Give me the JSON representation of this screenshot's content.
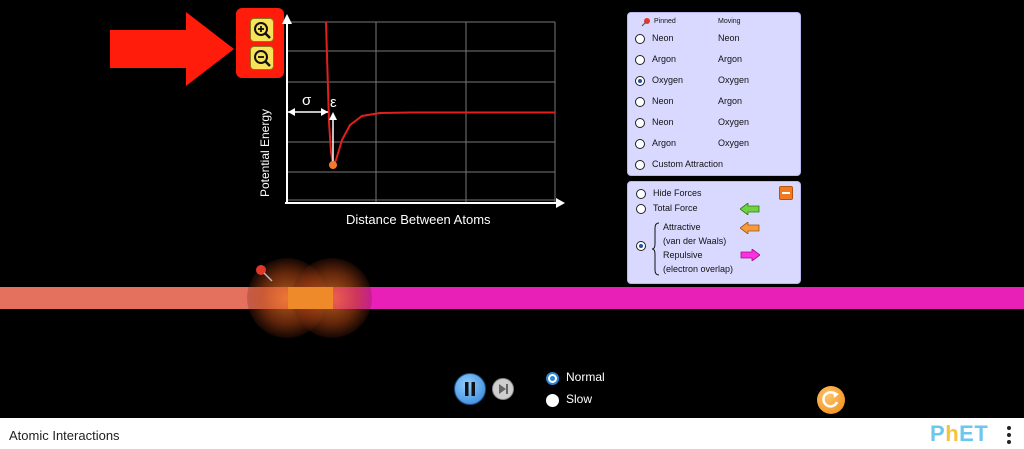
{
  "app": {
    "title": "Atomic Interactions"
  },
  "graph": {
    "y_axis_label": "Potential Energy",
    "x_axis_label": "Distance Between Atoms",
    "sigma_label": "σ",
    "epsilon_label": "ε"
  },
  "zoom": {
    "zoom_in_icon": "zoom-in-icon",
    "zoom_out_icon": "zoom-out-icon"
  },
  "atom_panel": {
    "header_pinned": "Pinned",
    "header_moving": "Moving",
    "rows": [
      {
        "pinned": "Neon",
        "moving": "Neon",
        "selected": false
      },
      {
        "pinned": "Argon",
        "moving": "Argon",
        "selected": false
      },
      {
        "pinned": "Oxygen",
        "moving": "Oxygen",
        "selected": true
      },
      {
        "pinned": "Neon",
        "moving": "Argon",
        "selected": false
      },
      {
        "pinned": "Neon",
        "moving": "Oxygen",
        "selected": false
      },
      {
        "pinned": "Argon",
        "moving": "Oxygen",
        "selected": false
      }
    ],
    "custom": "Custom Attraction"
  },
  "forces_panel": {
    "hide_forces": "Hide Forces",
    "total_force": "Total Force",
    "attractive_line1": "Attractive",
    "attractive_line2": "(van der Waals)",
    "repulsive_line1": "Repulsive",
    "repulsive_line2": "(electron overlap)",
    "colors": {
      "total": "#6fd23f",
      "attractive": "#f79a3c",
      "repulsive": "#ff2ee0"
    }
  },
  "time_controls": {
    "speed_normal": "Normal",
    "speed_slow": "Slow",
    "selected_speed": "Normal"
  },
  "colors": {
    "panel_bg": "#d9d8ff",
    "highlight": "#ff1c0a",
    "curve": "#e21f1f"
  }
}
